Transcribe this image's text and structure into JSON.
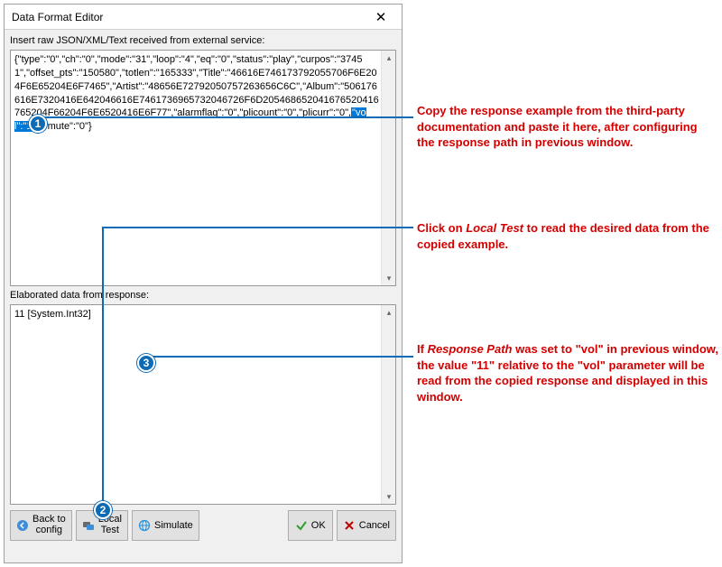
{
  "titlebar": {
    "title": "Data Format Editor"
  },
  "labels": {
    "raw": "Insert raw JSON/XML/Text received from external service:",
    "elaborated": "Elaborated data from response:"
  },
  "raw_textbox": {
    "pre_text": "{\"type\":\"0\",\"ch\":\"0\",\"mode\":\"31\",\"loop\":\"4\",\"eq\":\"0\",\"status\":\"play\",\"curpos\":\"37451\",\"offset_pts\":\"150580\",\"totlen\":\"165333\",\"Title\":\"46616E746173792055706F6E204F6E65204E6F7465\",\"Artist\":\"48656E72792050757263656C6C\",\"Album\":\"506176616E7320416E642046616E7461736965732046726F6D205468652041676520416765204F66204F6E6520416E6F77\",\"alarmflag\":\"0\",\"plicount\":\"0\",\"plicurr\":\"0\",",
    "selected_text": "\"vol\":\"11\"",
    "post_text": ",\"mute\":\"0\"}"
  },
  "elaborated_textbox": {
    "value": "11 [System.Int32]"
  },
  "buttons": {
    "back": {
      "line1": "Back to",
      "line2": "config"
    },
    "local_test": {
      "line1": "Local",
      "line2": "Test"
    },
    "simulate": "Simulate",
    "ok": "OK",
    "cancel": "Cancel"
  },
  "callouts": {
    "c1": {
      "num": "1",
      "text_parts": [
        "Copy the response example from the third-party documentation and paste it here, after configuring the response path in previous window."
      ]
    },
    "c2": {
      "num": "2",
      "text_pre": "Click on ",
      "text_italic": "Local Test",
      "text_post": " to read the desired data from the copied example."
    },
    "c3": {
      "num": "3",
      "text_pre": "If ",
      "text_italic": "Response Path",
      "text_post": " was set to \"vol\" in previous window, the value \"11\" relative to the \"vol\" parameter will be read from the copied response and displayed in this window."
    }
  }
}
